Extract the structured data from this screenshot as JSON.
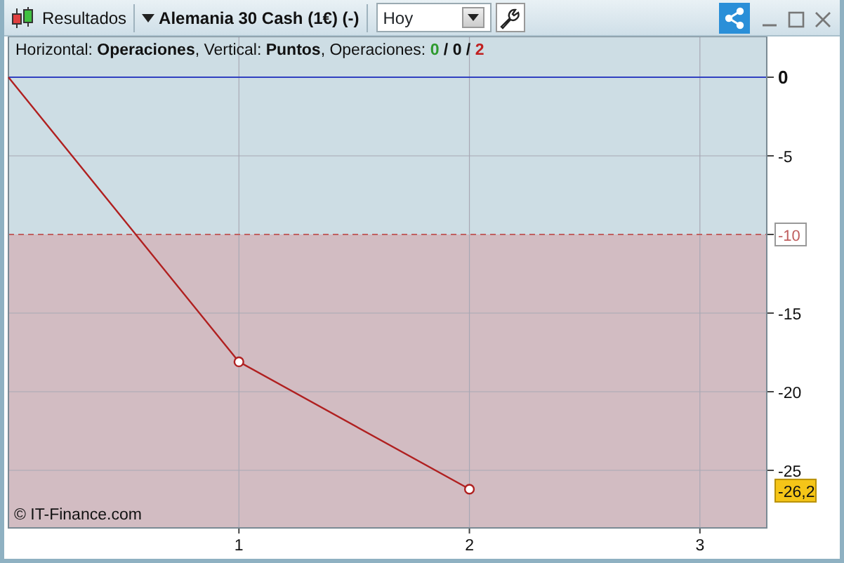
{
  "toolbar": {
    "results_label": "Resultados",
    "instrument": "Alemania 30 Cash (1€) (-)",
    "period": {
      "value": "Hoy"
    }
  },
  "chart": {
    "info": "Horizontal: **Operaciones**, Vertical: **Puntos**, Operaciones:",
    "separator": "/",
    "counts": [
      {
        "value": "0",
        "color": "#2e9a2e"
      },
      {
        "value": "0",
        "color": "#111111"
      },
      {
        "value": "2",
        "color": "#c02020"
      }
    ],
    "copyright": "© IT-Finance.com",
    "chart_data": {
      "type": "line",
      "x": [
        0,
        1,
        2
      ],
      "series": [
        {
          "color": "#b02020",
          "values": [
            0,
            -18.1,
            -26.2
          ]
        }
      ],
      "grid": true,
      "xlim": [
        0,
        3.29
      ],
      "ylim": [
        -28.66,
        2.59
      ],
      "xticks": [
        1,
        2,
        3
      ],
      "yticks": [
        0,
        -5,
        -10,
        -15,
        -20,
        -25
      ],
      "ref_lines": [
        {
          "axis": "y",
          "value": 0,
          "color": "#3040c0"
        },
        {
          "axis": "y",
          "value": -10,
          "color": "#c06060",
          "label": "-10"
        }
      ],
      "annotations": [
        "-26,2"
      ]
    }
  }
}
